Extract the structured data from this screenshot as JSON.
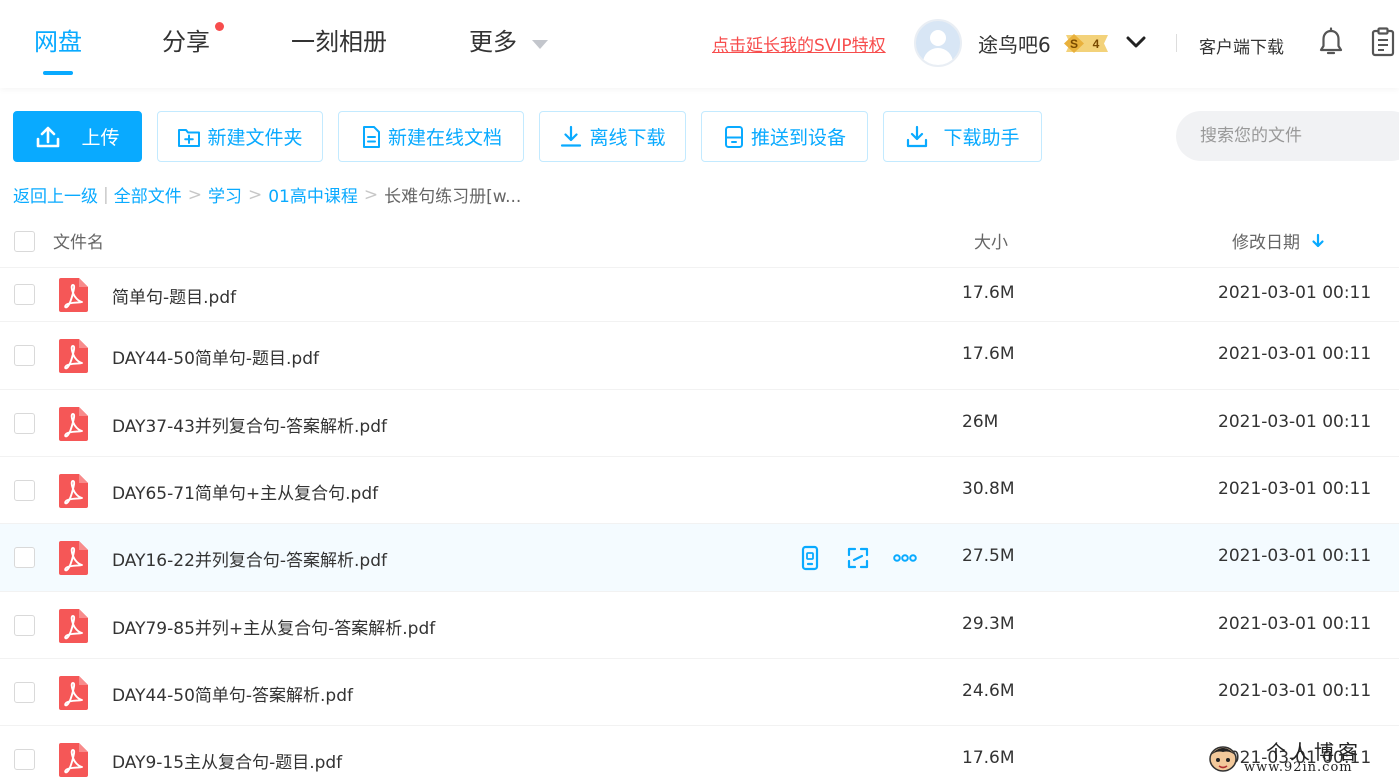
{
  "header": {
    "tabs": [
      {
        "label": "网盘",
        "active": true
      },
      {
        "label": "分享",
        "has_dot": true
      },
      {
        "label": "一刻相册"
      },
      {
        "label": "更多"
      }
    ],
    "svip_link": "点击延长我的SVIP特权",
    "username": "途鸟吧6",
    "vip_level": "4",
    "vip_symbol": "S",
    "client_download": "客户端下载"
  },
  "toolbar": {
    "upload": "上传",
    "new_folder": "新建文件夹",
    "new_doc": "新建在线文档",
    "offline_download": "离线下载",
    "push_device": "推送到设备",
    "download_helper": "下载助手",
    "search_placeholder": "搜索您的文件"
  },
  "breadcrumb": {
    "back": "返回上一级",
    "items": [
      "全部文件",
      "学习",
      "01高中课程"
    ],
    "current": "长难句练习册[w..."
  },
  "columns": {
    "name": "文件名",
    "size": "大小",
    "date": "修改日期"
  },
  "files": [
    {
      "name": "简单句-题目.pdf",
      "size": "17.6M",
      "date": "2021-03-01 00:11"
    },
    {
      "name": "DAY44-50简单句-题目.pdf",
      "size": "17.6M",
      "date": "2021-03-01 00:11"
    },
    {
      "name": "DAY37-43并列复合句-答案解析.pdf",
      "size": "26M",
      "date": "2021-03-01 00:11"
    },
    {
      "name": "DAY65-71简单句+主从复合句.pdf",
      "size": "30.8M",
      "date": "2021-03-01 00:11"
    },
    {
      "name": "DAY16-22并列复合句-答案解析.pdf",
      "size": "27.5M",
      "date": "2021-03-01 00:11",
      "hovered": true
    },
    {
      "name": "DAY79-85并列+主从复合句-答案解析.pdf",
      "size": "29.3M",
      "date": "2021-03-01 00:11"
    },
    {
      "name": "DAY44-50简单句-答案解析.pdf",
      "size": "24.6M",
      "date": "2021-03-01 00:11"
    },
    {
      "name": "DAY9-15主从复合句-题目.pdf",
      "size": "17.6M",
      "date": "2021-03-01 00:11"
    }
  ],
  "watermark": {
    "title": "个人博客",
    "url": "www.92in.com"
  },
  "colors": {
    "accent": "#09AAFF",
    "red": "#F74D4D",
    "pdf_red": "#F55757",
    "hover_row": "#F4FBFF"
  }
}
